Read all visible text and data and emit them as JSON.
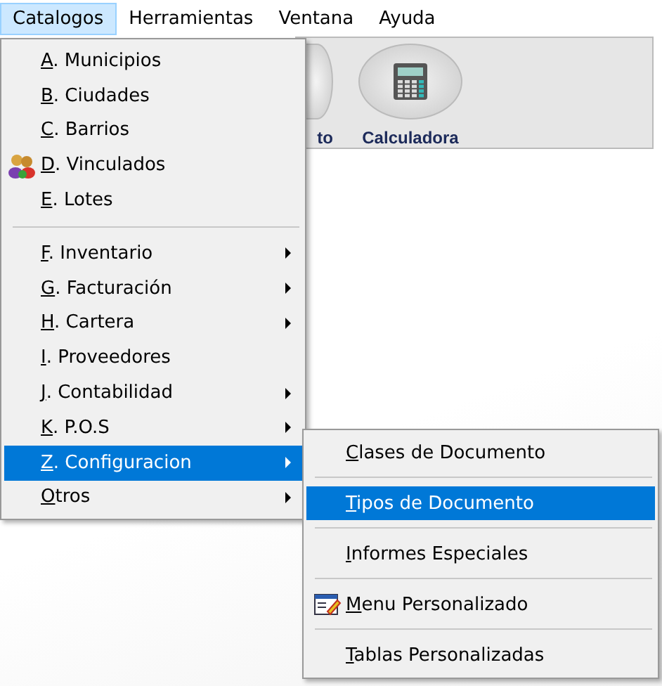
{
  "menubar": [
    {
      "label": "Catalogos",
      "selected": true
    },
    {
      "label": "Herramientas",
      "selected": false
    },
    {
      "label": "Ventana",
      "selected": false
    },
    {
      "label": "Ayuda",
      "selected": false
    }
  ],
  "toolbar": [
    {
      "label": "to",
      "kind": "round"
    },
    {
      "label": "Calculadora",
      "kind": "calculator"
    }
  ],
  "menu": [
    {
      "label": "A. Municipios",
      "kind": "item",
      "icon": false,
      "submenu": false,
      "selected": false
    },
    {
      "label": "B. Ciudades",
      "kind": "item",
      "icon": false,
      "submenu": false,
      "selected": false
    },
    {
      "label": "C. Barrios",
      "kind": "item",
      "icon": false,
      "submenu": false,
      "selected": false
    },
    {
      "label": "D. Vinculados",
      "kind": "item",
      "icon": true,
      "submenu": false,
      "selected": false
    },
    {
      "label": "E. Lotes",
      "kind": "item",
      "icon": false,
      "submenu": false,
      "selected": false
    },
    {
      "kind": "separator"
    },
    {
      "label": "F.  Inventario",
      "kind": "item",
      "icon": false,
      "submenu": true,
      "selected": false
    },
    {
      "label": "G. Facturación",
      "kind": "item",
      "icon": false,
      "submenu": true,
      "selected": false
    },
    {
      "label": "H. Cartera",
      "kind": "item",
      "icon": false,
      "submenu": true,
      "selected": false
    },
    {
      "label": "I.  Proveedores",
      "kind": "item",
      "icon": false,
      "submenu": false,
      "selected": false
    },
    {
      "label": "J. Contabilidad",
      "kind": "item",
      "icon": false,
      "submenu": true,
      "selected": false
    },
    {
      "label": "K. P.O.S",
      "kind": "item",
      "icon": false,
      "submenu": true,
      "selected": false
    },
    {
      "label": "Z. Configuracion",
      "kind": "item",
      "icon": false,
      "submenu": true,
      "selected": true
    },
    {
      "label": "Otros",
      "kind": "item",
      "icon": false,
      "submenu": true,
      "selected": false
    }
  ],
  "submenu": [
    {
      "label": "Clases de Documento",
      "kind": "item",
      "icon": false,
      "selected": false
    },
    {
      "kind": "separator"
    },
    {
      "label": "Tipos de Documento",
      "kind": "item",
      "icon": false,
      "selected": true
    },
    {
      "kind": "separator"
    },
    {
      "label": "Informes Especiales",
      "kind": "item",
      "icon": false,
      "selected": false
    },
    {
      "kind": "separator"
    },
    {
      "label": "Menu Personalizado",
      "kind": "item",
      "icon": true,
      "selected": false
    },
    {
      "kind": "separator"
    },
    {
      "label": "Tablas Personalizadas",
      "kind": "item",
      "icon": false,
      "selected": false
    }
  ]
}
